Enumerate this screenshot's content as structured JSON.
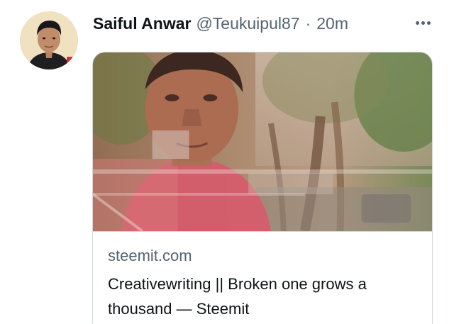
{
  "tweet": {
    "author": {
      "display_name": "Saiful Anwar",
      "handle": "@Teukuipul87",
      "avatar_icon": "user-avatar-photo"
    },
    "separator": "·",
    "timestamp": "20m",
    "more_icon": "more-horizontal-icon",
    "link_card": {
      "image": "collage-photo-man-and-trees",
      "domain": "steemit.com",
      "title": "Creativewriting || Broken one grows a thousand — Steemit"
    }
  },
  "colors": {
    "text_primary": "#0f1419",
    "text_secondary": "#536471",
    "border": "#cfd9de"
  }
}
